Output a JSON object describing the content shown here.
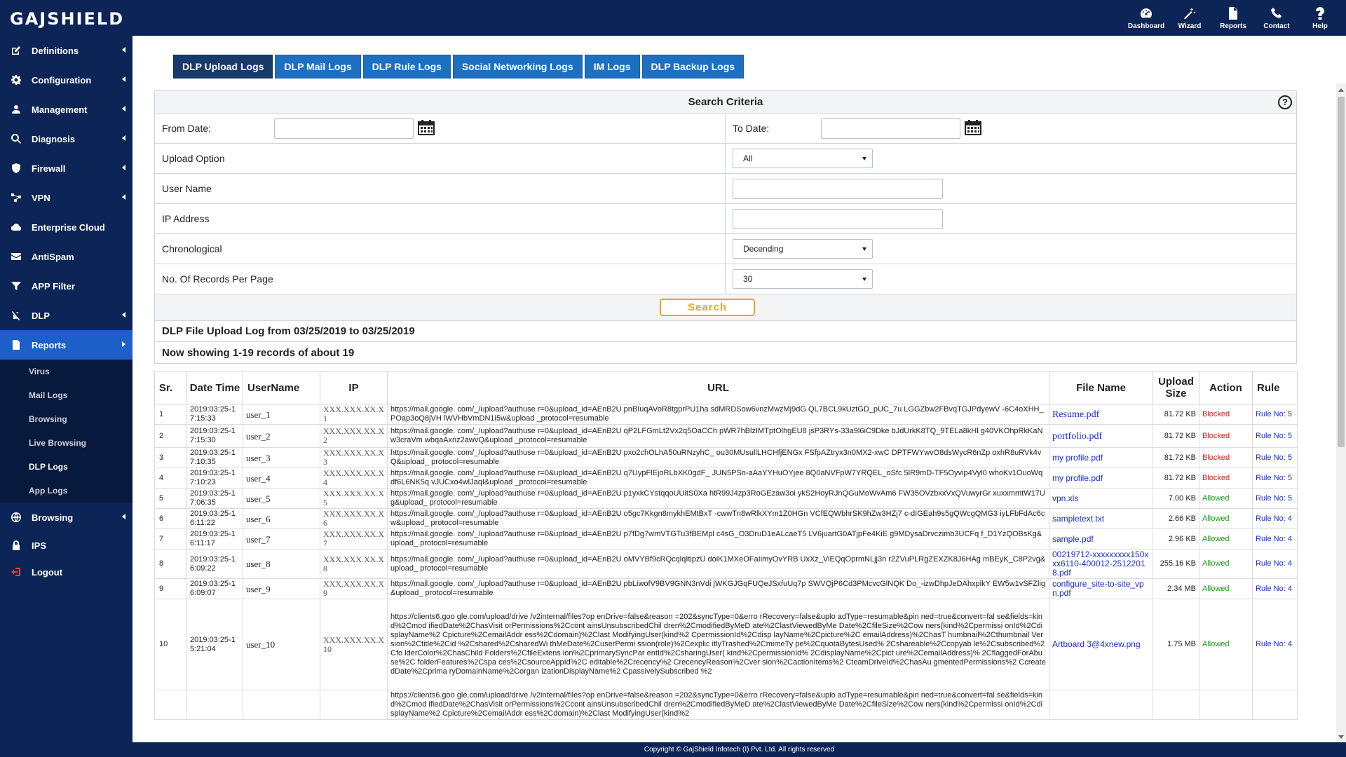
{
  "brand": {
    "logo": "GAJSHIELD"
  },
  "topnav": [
    {
      "label": "Dashboard",
      "icon": "dashboard-icon"
    },
    {
      "label": "Wizard",
      "icon": "wizard-icon"
    },
    {
      "label": "Reports",
      "icon": "reports-icon"
    },
    {
      "label": "Contact",
      "icon": "phone-icon"
    },
    {
      "label": "Help",
      "icon": "help-icon"
    }
  ],
  "sidebar": {
    "items": [
      {
        "label": "Definitions",
        "icon": "edit-icon"
      },
      {
        "label": "Configuration",
        "icon": "gear-icon"
      },
      {
        "label": "Management",
        "icon": "user-icon"
      },
      {
        "label": "Diagnosis",
        "icon": "search-icon"
      },
      {
        "label": "Firewall",
        "icon": "shield-icon"
      },
      {
        "label": "VPN",
        "icon": "network-icon"
      },
      {
        "label": "Enterprise Cloud",
        "icon": "cloud-icon"
      },
      {
        "label": "AntiSpam",
        "icon": "envelope-icon"
      },
      {
        "label": "APP Filter",
        "icon": "filter-icon"
      },
      {
        "label": "DLP",
        "icon": "dlp-icon"
      },
      {
        "label": "Reports",
        "icon": "document-icon"
      }
    ],
    "sub_items": [
      "Virus",
      "Mail Logs",
      "Browsing",
      "Live Browsing",
      "DLP Logs",
      "App Logs"
    ],
    "bottom_items": [
      {
        "label": "Browsing",
        "icon": "globe-icon"
      },
      {
        "label": "IPS",
        "icon": "lock-icon"
      },
      {
        "label": "Logout",
        "icon": "logout-icon"
      }
    ]
  },
  "tabs": [
    "DLP Upload Logs",
    "DLP Mail Logs",
    "DLP Rule Logs",
    "Social Networking Logs",
    "IM Logs",
    "DLP Backup Logs"
  ],
  "search": {
    "title": "Search Criteria",
    "help": "?",
    "from_date_label": "From Date:",
    "to_date_label": "To Date:",
    "upload_option_label": "Upload Option",
    "upload_option_value": "All",
    "user_name_label": "User Name",
    "ip_address_label": "IP Address",
    "chronological_label": "Chronological",
    "chronological_value": "Decending",
    "records_label": "No. Of Records Per Page",
    "records_value": "30",
    "button": "Search"
  },
  "summary": {
    "title": "DLP File Upload Log from 03/25/2019 to 03/25/2019",
    "showing": "Now showing 1-19 records of about 19"
  },
  "table": {
    "headers": [
      "Sr.",
      "Date Time",
      "UserName",
      "IP",
      "URL",
      "File Name",
      "Upload Size",
      "Action",
      "Rule"
    ],
    "rows": [
      {
        "sr": "1",
        "dt": "2019:03:25-17:15:33",
        "user": "user_1",
        "ip": "XXX.XXX.XX.X1",
        "url": "https://mail.google. com/_/upload?authuse r=0&upload_id=AEnB2U pnBIuqAVoR8tgprPU1ha sdMRDSow6vnzMwzMj9dG QL7BCL9kUztGD_pUC_7u LGGZbw2FBvqTGJPdyewV -6C4oXHH_POap3oQ8jVH lWVHbVmDN1i5w&upload _protocol=resumable",
        "file": "Resume.pdf",
        "size": "81.72 KB",
        "action": "Blocked",
        "rule": "Rule No: 5"
      },
      {
        "sr": "2",
        "dt": "2019:03:25-17:15:30",
        "user": "user_2",
        "ip": "XXX.XXX.XX.X2",
        "url": "https://mail.google. com/_/upload?authuse r=0&upload_id=AEnB2U qP2LFGmLt2Vx2q5OaCCh pWR7hBlzIMTptOlhgEU8 jsP3RYs-33a9l6iC9Dke bJdUrkK8TQ_9TELa8kHl g40VKOhpRkKaNw3craVm wbqaAxnz2awvQ&upload _protocol=resumable",
        "file": "portfolio.pdf",
        "size": "81.72 KB",
        "action": "Blocked",
        "rule": "Rule No: 5"
      },
      {
        "sr": "3",
        "dt": "2019:03:25-17:10:35",
        "user": "user_3",
        "ip": "XXX.XXX.XX.X3",
        "url": "https://mail.google. com/_/upload?authuse r=0&upload_id=AEnB2U pxo2chOLhA50uRNzyhC_ ou30MUsullLHCHfjENGx FSfpAZtryx3n0MX2-xwC DPTFWYwvO8dsWycR6nZp oxhR8uRVk4vQ&upload_ protocol=resumable",
        "file": "my profile.pdf",
        "size": "81.72 KB",
        "action": "Blocked",
        "rule": "Rule No: 5"
      },
      {
        "sr": "4",
        "dt": "2019:03:25-17:10:23",
        "user": "user_4",
        "ip": "XXX.XXX.XX.X4",
        "url": "https://mail.google. com/_/upload?authuse r=0&upload_id=AEnB2U q7UypFlEjoRLbXK0gdF_ JUN5PSn-aAaYYHuOYjee 8Q0aNVFpW7YRQEL_oSfc 5lR9mD-TF5Oyvip4Vyl0 whoKv1OuoWqdf6L6NK5q vJUCxo4wlJaqI&upload _protocol=resumable",
        "file": "my profile.pdf",
        "size": "81.72 KB",
        "action": "Blocked",
        "rule": "Rule No: 5"
      },
      {
        "sr": "5",
        "dt": "2019:03:25-17:06:35",
        "user": "user_5",
        "ip": "XXX.XXX.XX.X5",
        "url": "https://mail.google. com/_/upload?authuse r=0&upload_id=AEnB2U p1yxkCYstqqoUUitS0Xa htR99J4zp3RoGEzaw3oi ykS2HoyRJnQGuMoWvAm6 FW35OVzbxxVxQVuwyrGr xuxxmmtW17Ug&upload_ protocol=resumable",
        "file": "vpn.xls",
        "size": "7.00 KB",
        "action": "Allowed",
        "rule": "Rule No: 5"
      },
      {
        "sr": "6",
        "dt": "2019:03:25-16:11:22",
        "user": "user_6",
        "ip": "XXX.XXX.XX.X6",
        "url": "https://mail.google. com/_/upload?authuse r=0&upload_id=AEnB2U o5gc7Kkgn8mykhEMtBxT -cwwTn8wRlkXYm1Z0HGn VCfEQWbhrSK9hZw3HZj7 c-dIGEah9s5gQWcgQMG3 iyLFbFdAc6cw&upload_ protocol=resumable",
        "file": "sampletext.txt",
        "size": "2.66 KB",
        "action": "Allowed",
        "rule": "Rule No: 4"
      },
      {
        "sr": "7",
        "dt": "2019:03:25-16:11:17",
        "user": "user_7",
        "ip": "XXX.XXX.XX.X7",
        "url": "https://mail.google. com/_/upload?authuse r=0&upload_id=AEnB2U p7fDg7wmVTGTu3fBEMpl c4sG_O3DruD1eALcaeT5 LV6juartG0ATjpFe4KiE g9MDysaDrvczimb3UCFq f_D1YzQOBsKg&upload_ protocol=resumable",
        "file": "sample.pdf",
        "size": "2.96 KB",
        "action": "Allowed",
        "rule": "Rule No: 4"
      },
      {
        "sr": "8",
        "dt": "2019:03:25-16:09:22",
        "user": "user_8",
        "ip": "XXX.XXX.XX.X8",
        "url": "https://mail.google. com/_/upload?authuse r=0&upload_id=AEnB2U oMVYBf9cRQcqlqItipzU doiK1MXeOFaIimyOvYRB UxXz_ViEQqOprmNLjj3n r2ZVuPLRgZEXZK8J6HAg mBEyK_C8P2vg&upload_ protocol=resumable",
        "file": "00219712-xxxxxxxxx150xxx6110-400012-25122018.pdf",
        "size": "255.16 KB",
        "action": "Allowed",
        "rule": "Rule No: 4"
      },
      {
        "sr": "9",
        "dt": "2019:03:25-16:09:07",
        "user": "user_9",
        "ip": "XXX.XXX.XX.X9",
        "url": "https://mail.google. com/_/upload?authuse r=0&upload_id=AEnB2U pbLiwofV9BV9GNN3nVdi jWKGJGqFUQeJSxfuUq7p SWVQjP6Cd3PMcvcGlNQK Do_-izwDhpJeDAhxpikY EW5w1vSFZlig&upload_ protocol=resumable",
        "file": "configure_site-to-site_vpn.pdf",
        "size": "2.34 MB",
        "action": "Allowed",
        "rule": "Rule No: 4"
      },
      {
        "sr": "10",
        "dt": "2019:03:25-15:21:04",
        "user": "user_10",
        "ip": "XXX.XXX.XX.X10",
        "url": "https://clients6.goo gle.com/upload/drive /v2internal/files?op enDrive=false&reason =202&syncType=0&erro rRecovery=false&uplo adType=resumable&pin ned=true&convert=fal se&fields=kind%2Cmod ifiedDate%2ChasVisit orPermissions%2Ccont ainsUnsubscribedChil dren%2CmodifiedByMeD ate%2ClastViewedByMe Date%2CfileSize%2Cow ners(kind%2Cpermissi onId%2CdisplayName%2 Cpicture%2CemailAddr ess%2Cdomain)%2Clast ModifyingUser(kind%2 CpermissionId%2Cdisp layName%2Cpicture%2C emailAddress)%2ChasT humbnail%2Cthumbnail Version%2Ctitle%2Cid %2Cshared%2CsharedWi thMeDate%2CuserPermi ssion(role)%2Cexplic itlyTrashed%2CmimeTy pe%2CquotaBytesUsed% 2Cshareable%2Ccopyab le%2Csubscribed%2Cfo lderColor%2ChasChild Folders%2CfileExtens ion%2CprimarySyncPar entId%2CsharingUser( kind%2CpermissionId% 2CdisplayName%2Cpict ure%2CemailAddress)% 2CflaggedForAbuse%2C folderFeatures%2Cspa ces%2CsourceAppId%2C editable%2Crecency%2 CrecencyReason%2Cver sion%2CactionItems%2 CteamDriveId%2ChasAu gmentedPermissions%2 CcreatedDate%2Cprima ryDomainName%2Corgan izationDisplayName%2 CpassivelySubscribed %2",
        "file": "Artboard 3@4xnew.png",
        "size": "1.75 MB",
        "action": "Allowed",
        "rule": "Rule No: 4"
      },
      {
        "sr": "",
        "dt": "",
        "user": "",
        "ip": "",
        "url": "https://clients6.goo gle.com/upload/drive /v2internal/files?op enDrive=false&reason =202&syncType=0&erro rRecovery=false&uplo adType=resumable&pin ned=true&convert=fal se&fields=kind%2Cmod ifiedDate%2ChasVisit orPermissions%2Ccont ainsUnsubscribedChil dren%2CmodifiedByMeD ate%2ClastViewedByMe Date%2CfileSize%2Cow ners(kind%2Cpermissi onId%2CdisplayName%2 Cpicture%2CemailAddr ess%2Cdomain)%2Clast ModifyingUser(kind%2",
        "file": "",
        "size": "",
        "action": "",
        "rule": ""
      }
    ]
  },
  "footer": "Copyright © GajShield Infotech (I) Pvt. Ltd. All rights reserved",
  "colors": {
    "navy": "#0c2556",
    "active_blue": "#1d5fc8",
    "tab_blue": "#1d6fc1",
    "tab_active": "#173a6b",
    "search_orange": "#f0a329",
    "blocked": "#e01818",
    "allowed": "#119a11",
    "link": "#1a2bd0"
  }
}
